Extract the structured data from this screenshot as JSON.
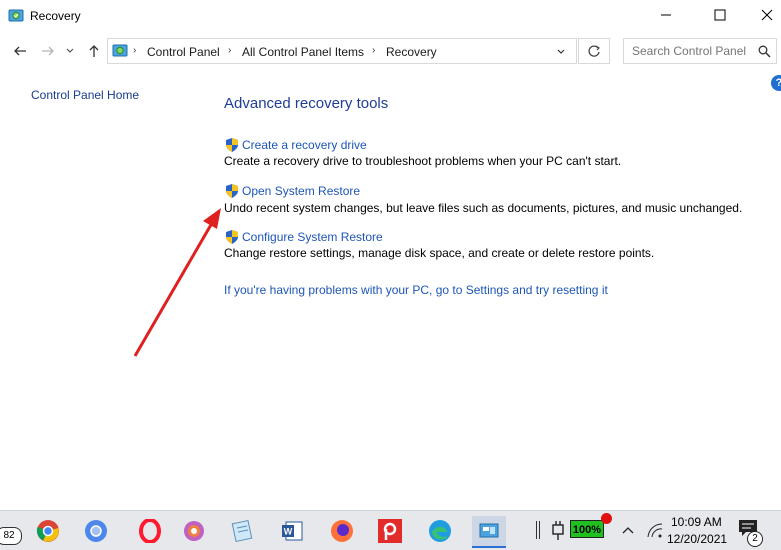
{
  "window": {
    "title": "Recovery",
    "controls": {
      "minimize": "minimize",
      "maximize": "maximize",
      "close": "close"
    }
  },
  "navigation": {
    "breadcrumb": [
      "Control Panel",
      "All Control Panel Items",
      "Recovery"
    ],
    "search_placeholder": "Search Control Panel"
  },
  "sidebar": {
    "home_link": "Control Panel Home"
  },
  "main": {
    "heading": "Advanced recovery tools",
    "tools": [
      {
        "label": "Create a recovery drive",
        "description": "Create a recovery drive to troubleshoot problems when your PC can't start."
      },
      {
        "label": "Open System Restore",
        "description": "Undo recent system changes, but leave files such as documents, pictures, and music unchanged."
      },
      {
        "label": "Configure System Restore",
        "description": "Change restore settings, manage disk space, and create or delete restore points."
      }
    ],
    "reset_link": "If you're having problems with your PC, go to Settings and try resetting it"
  },
  "annotation": {
    "arrow_color": "#e02020"
  },
  "taskbar": {
    "left_badge": "82",
    "apps": [
      "chrome",
      "chromium",
      "opera",
      "photos",
      "notepad",
      "word",
      "firefox",
      "pdf-reader",
      "edge",
      "control-panel"
    ],
    "battery_percent": "100%",
    "clock_time": "10:09 AM",
    "clock_date": "12/20/2021",
    "notifications_count": "2"
  }
}
